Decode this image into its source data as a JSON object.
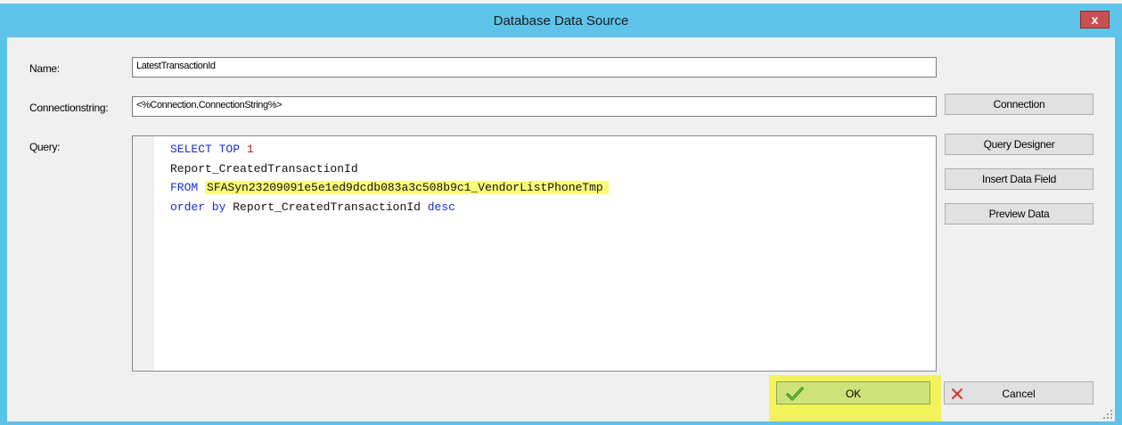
{
  "window": {
    "title": "Database Data Source",
    "close_label": "x"
  },
  "form": {
    "name_label": "Name:",
    "name_value": "LatestTransactionId",
    "connectionstring_label": "Connectionstring:",
    "connectionstring_value": "<%Connection.ConnectionString%>",
    "query_label": "Query:"
  },
  "query": {
    "line1_keyword": "SELECT TOP",
    "line1_number": "1",
    "line2": "Report_CreatedTransactionId",
    "line3_keyword": "FROM",
    "line3_table": "SFASyn23209091e5e1ed9dcdb083a3c508b9c1_VendorListPhoneTmp",
    "line4_keyword": "order by",
    "line4_column": "Report_CreatedTransactionId",
    "line4_direction": "desc"
  },
  "buttons": {
    "connection": "Connection",
    "query_designer": "Query Designer",
    "insert_data_field": "Insert Data Field",
    "preview_data": "Preview Data",
    "ok": "OK",
    "cancel": "Cancel"
  },
  "colors": {
    "titlebar": "#5fc4ea",
    "highlight": "#f2f25a",
    "keyword": "#1a2fcc",
    "number": "#b01818"
  },
  "icons": {
    "ok": "check-icon",
    "cancel": "x-icon",
    "close": "close-icon"
  }
}
